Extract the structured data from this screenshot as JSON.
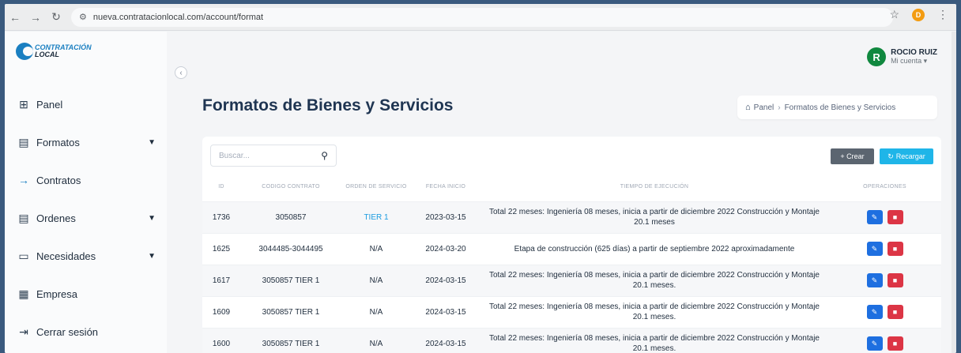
{
  "browser": {
    "url": "nueva.contratacionlocal.com/account/format",
    "profile_initial": "D"
  },
  "logo": {
    "line1": "CONTRATACIÓN",
    "line2": "LOCAL"
  },
  "sidebar": {
    "items": [
      {
        "label": "Panel",
        "icon": "grid-icon"
      },
      {
        "label": "Formatos",
        "icon": "clipboard-icon",
        "has_caret": true
      },
      {
        "label": "Contratos",
        "icon": "arrow-right-icon"
      },
      {
        "label": "Ordenes",
        "icon": "clipboard-icon",
        "has_caret": true
      },
      {
        "label": "Necesidades",
        "icon": "briefcase-icon",
        "has_caret": true
      },
      {
        "label": "Empresa",
        "icon": "building-icon"
      },
      {
        "label": "Cerrar sesión",
        "icon": "logout-icon"
      }
    ]
  },
  "user": {
    "initial": "R",
    "name": "ROCIO RUIZ",
    "sub": "Mi cuenta ▾"
  },
  "page_title": "Formatos de Bienes y Servicios",
  "breadcrumb": {
    "home": "Panel",
    "current": "Formatos de Bienes y Servicios"
  },
  "toolbar": {
    "search_placeholder": "Buscar...",
    "crear_label": "+ Crear",
    "recargar_label": "Recargar"
  },
  "table": {
    "headers": [
      "ID",
      "CODIGO CONTRATO",
      "ORDEN DE SERVICIO",
      "FECHA INICIO",
      "TIEMPO DE EJECUCIÓN",
      "OPERACIONES"
    ],
    "rows": [
      {
        "id": "1736",
        "codigo": "3050857",
        "orden": "TIER 1",
        "fecha": "2023-03-15",
        "tiempo": "Total 22 meses: Ingeniería 08 meses, inicia a partir de diciembre 2022 Construcción y Montaje 20.1 meses"
      },
      {
        "id": "1625",
        "codigo": "3044485-3044495",
        "orden": "N/A",
        "fecha": "2024-03-20",
        "tiempo": "Etapa de construcción (625 días) a partir de septiembre 2022 aproximadamente"
      },
      {
        "id": "1617",
        "codigo": "3050857 TIER 1",
        "orden": "N/A",
        "fecha": "2024-03-15",
        "tiempo": "Total 22 meses: Ingeniería 08 meses, inicia a partir de diciembre 2022 Construcción y Montaje 20.1 meses."
      },
      {
        "id": "1609",
        "codigo": "3050857 TIER 1",
        "orden": "N/A",
        "fecha": "2024-03-15",
        "tiempo": "Total 22 meses: Ingeniería 08 meses, inicia a partir de diciembre 2022 Construcción y Montaje 20.1 meses."
      },
      {
        "id": "1600",
        "codigo": "3050857 TIER 1",
        "orden": "N/A",
        "fecha": "2024-03-15",
        "tiempo": "Total 22 meses: Ingeniería 08 meses, inicia a partir de diciembre 2022 Construcción y Montaje 20.1 meses."
      }
    ]
  },
  "colors": {
    "accent": "#1a7fc1",
    "edit": "#1e6fe0",
    "delete": "#dc3545",
    "recargar": "#1fb5e8",
    "avatar": "#10883f"
  }
}
